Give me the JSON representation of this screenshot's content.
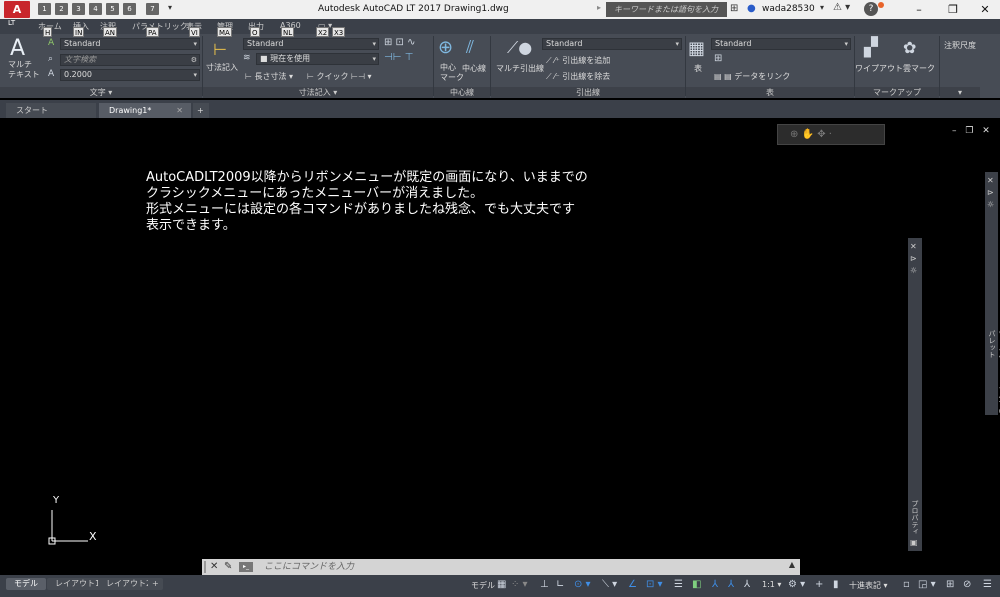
{
  "titlebar": {
    "app_logo": "A",
    "app_logo_sub": "LT",
    "title": "Autodesk AutoCAD LT 2017   Drawing1.dwg",
    "search_placeholder": "キーワードまたは語句を入力",
    "user_name": "wada28530",
    "quick_access_tips": [
      "1",
      "2",
      "3",
      "4",
      "5",
      "6",
      "7"
    ]
  },
  "ribbon_tabs": [
    {
      "label": "ホーム",
      "keytip": "H"
    },
    {
      "label": "挿入",
      "keytip": "IN"
    },
    {
      "label": "注釈",
      "keytip": "AN"
    },
    {
      "label": "パラメトリック",
      "keytip": "PA"
    },
    {
      "label": "表示",
      "keytip": "VI"
    },
    {
      "label": "管理",
      "keytip": "MA"
    },
    {
      "label": "出力",
      "keytip": "O"
    },
    {
      "label": "A360",
      "keytip": "NL"
    },
    {
      "label": "",
      "keytip": "X2"
    },
    {
      "label": "",
      "keytip": "X3"
    }
  ],
  "ribbon": {
    "text_panel": {
      "title": "文字 ▾",
      "multiline_label": "マルチ\nテキスト",
      "text_style": "Standard",
      "search_placeholder": "文字検索",
      "text_height": "0.2000"
    },
    "dimension_panel": {
      "title": "寸法記入 ▾",
      "big_button": "寸法記入",
      "dim_style": "Standard",
      "layer_combo": "現在を使用",
      "linear": "長さ寸法 ▾",
      "quick": "クイック"
    },
    "centerline_panel": {
      "title": "中心線",
      "center_mark": "中心\nマーク",
      "centerline": "中心線"
    },
    "leader_panel": {
      "title": "引出線",
      "multileader": "マルチ引出線",
      "leader_style": "Standard",
      "add_leader": "引出線を追加",
      "remove_leader": "引出線を除去"
    },
    "table_panel": {
      "title": "表",
      "table_button": "表",
      "table_style": "Standard",
      "data_link": "データをリンク"
    },
    "markup_panel": {
      "title": "マークアップ",
      "wipeout": "ワイプアウト",
      "revcloud": "雲マーク"
    },
    "annotation_scale_panel": {
      "title": "注釈尺度"
    }
  },
  "doc_tabs": {
    "start": "スタート",
    "drawing": "Drawing1*",
    "new_tab": "+"
  },
  "canvas": {
    "note_lines": [
      "AutoCADLT2009以降からリボンメニューが既定の画面になり、いままでの",
      "クラシックメニューにあったメニューバーが消えました。",
      "形式メニューには設定の各コマンドがありましたね残念、でも大丈夫です",
      "表示できます。"
    ],
    "ucs_x": "X",
    "ucs_y": "Y",
    "palette_right_label": "ツールパレット - すべてのパレット",
    "palette_mid_label": "プロパティ"
  },
  "command_line": {
    "placeholder": "ここにコマンドを入力"
  },
  "statusbar": {
    "layout_tabs": [
      "モデル",
      "レイアウト1",
      "レイアウト2",
      "+"
    ],
    "model_label": "モデル",
    "scale": "1:1",
    "units": "十進表記"
  }
}
